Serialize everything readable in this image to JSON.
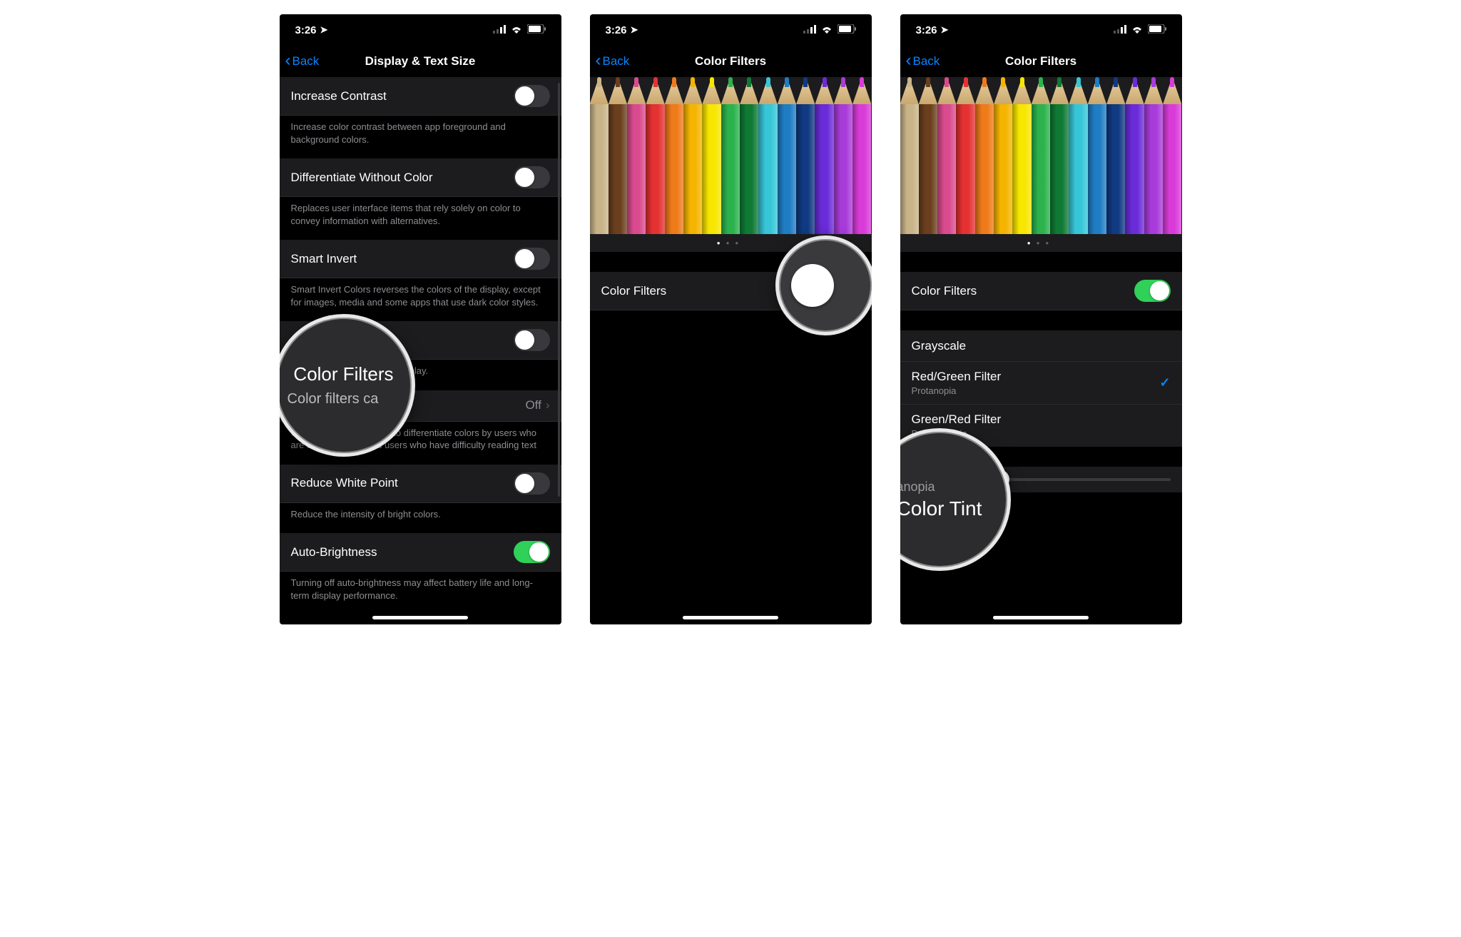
{
  "status": {
    "time": "3:26",
    "locationGlyph": "➤"
  },
  "screen1": {
    "back": "Back",
    "title": "Display & Text Size",
    "rows": {
      "increaseContrast": {
        "label": "Increase Contrast",
        "on": false
      },
      "increaseContrastFooter": "Increase color contrast between app foreground and background colors.",
      "diffColor": {
        "label": "Differentiate Without Color",
        "on": false
      },
      "diffColorFooter": "Replaces user interface items that rely solely on color to convey information with alternatives.",
      "smartInvert": {
        "label": "Smart Invert",
        "on": false
      },
      "smartInvertFooter": "Smart Invert Colors reverses the colors of the display, except for images, media and some apps that use dark color styles.",
      "classicInvert": {
        "label": "",
        "on": false
      },
      "classicInvertFooter": "reverses the colors of the display.",
      "colorFilters": {
        "label": "Color Filters",
        "value": "Off"
      },
      "colorFiltersFooter": "Color filters can be used to differentiate colors by users who are color blind and aid users who have difficulty reading text",
      "reduceWhite": {
        "label": "Reduce White Point",
        "on": false
      },
      "reduceWhiteFooter": "Reduce the intensity of bright colors.",
      "autoBrightness": {
        "label": "Auto-Brightness",
        "on": true
      },
      "autoBrightnessFooter": "Turning off auto-brightness may affect battery life and long-term display performance."
    },
    "magnifier": {
      "title": "Color Filters",
      "sub": "Color filters ca"
    }
  },
  "screen2": {
    "back": "Back",
    "title": "Color Filters",
    "row": {
      "label": "Color Filters",
      "on": false
    }
  },
  "screen3": {
    "back": "Back",
    "title": "Color Filters",
    "row": {
      "label": "Color Filters",
      "on": true
    },
    "options": [
      {
        "label": "Grayscale",
        "sub": "",
        "checked": false
      },
      {
        "label": "Red/Green Filter",
        "sub": "Protanopia",
        "checked": true
      },
      {
        "label": "Green/Red Filter",
        "sub": "Deuteranopia",
        "checked": false
      }
    ],
    "magnifier": {
      "over": "tanopia",
      "title": "Color Tint"
    }
  },
  "pencilColors": [
    "#c8b488",
    "#6b3f1e",
    "#d94b8e",
    "#e53131",
    "#ef7a1a",
    "#f4b400",
    "#f7e600",
    "#2bb24c",
    "#0e7a34",
    "#36c6d8",
    "#1f7dc4",
    "#103a82",
    "#6a2bd9",
    "#a83bd9",
    "#d93bd9"
  ]
}
